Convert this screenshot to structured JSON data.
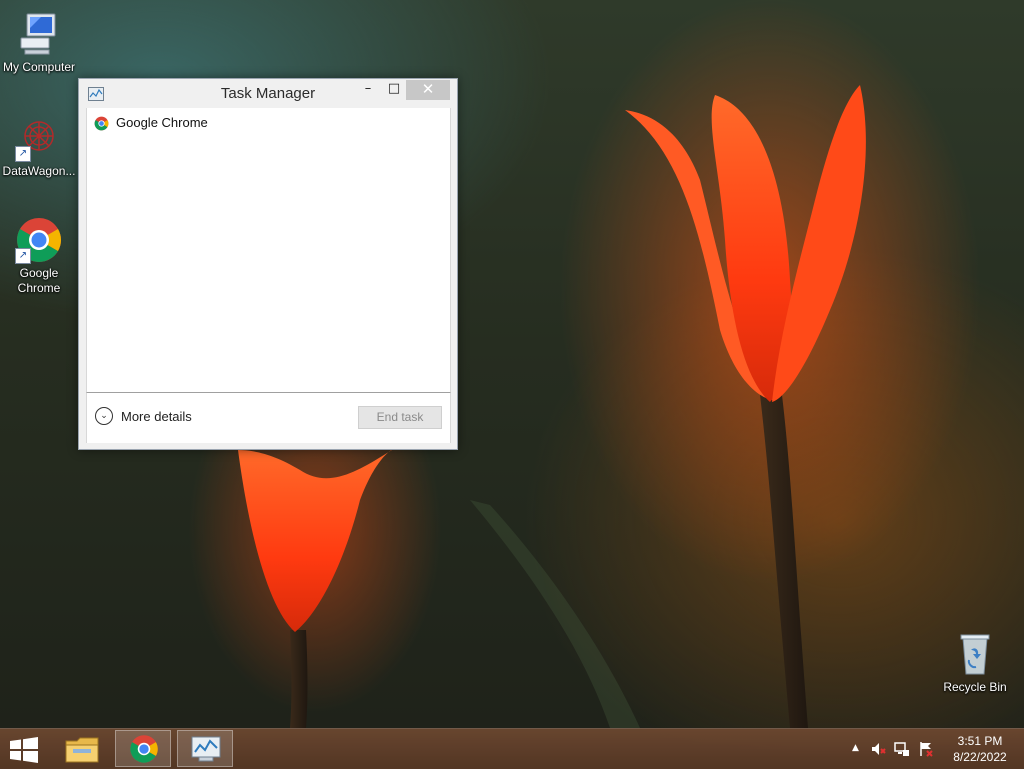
{
  "desktop": {
    "icons": [
      {
        "label": "My Computer",
        "icon": "computer-icon"
      },
      {
        "label": "DataWagon...",
        "icon": "datawagon-icon"
      },
      {
        "label": "Google Chrome",
        "icon": "chrome-icon"
      },
      {
        "label": "Recycle Bin",
        "icon": "recycle-bin-icon"
      }
    ]
  },
  "task_manager": {
    "title": "Task Manager",
    "controls": {
      "minimize": "–",
      "maximize": "□",
      "close": "✕"
    },
    "processes": [
      {
        "name": "Google Chrome",
        "icon": "chrome-icon"
      }
    ],
    "footer": {
      "more_details": "More details",
      "end_task": "End task"
    }
  },
  "taskbar": {
    "items": [
      "start-icon",
      "file-explorer-icon",
      "chrome-icon",
      "task-manager-icon"
    ],
    "active_item": "chrome-icon",
    "tray": {
      "show_hidden": "▲",
      "icons": [
        "volume-muted-icon",
        "network-icon",
        "action-center-icon"
      ]
    },
    "clock": {
      "time": "3:51 PM",
      "date": "8/22/2022"
    }
  },
  "colors": {
    "accent_close": "#c7c7c7",
    "taskbar": "#6e4830",
    "flower": "#ff5a1e"
  }
}
